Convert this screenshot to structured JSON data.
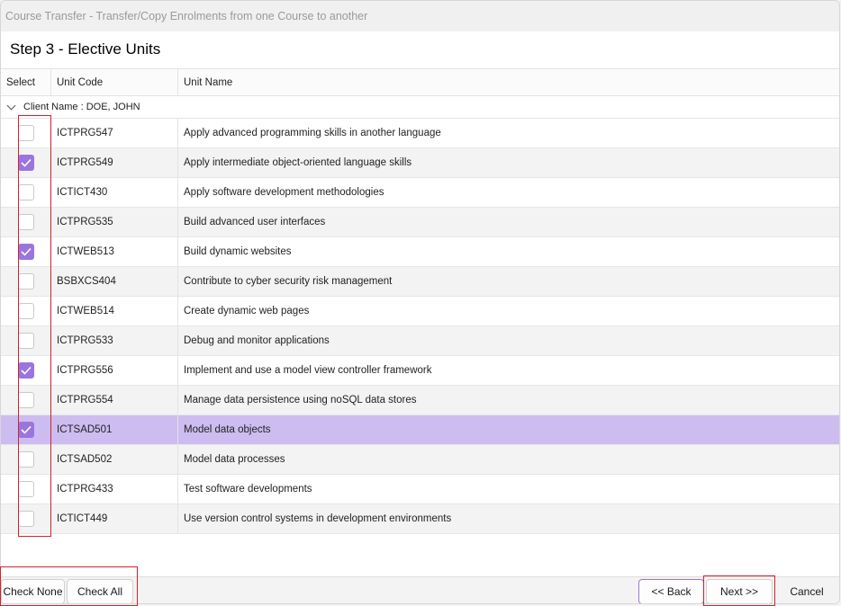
{
  "window": {
    "title": "Course Transfer  - Transfer/Copy Enrolments from one Course to another",
    "step_title": "Step 3 - Elective Units"
  },
  "grid": {
    "columns": {
      "select": "Select",
      "code": "Unit Code",
      "name": "Unit Name"
    },
    "group_label": "Client Name : DOE, JOHN",
    "rows": [
      {
        "code": "ICTPRG547",
        "name": "Apply advanced programming skills in another language",
        "checked": false,
        "selected": false
      },
      {
        "code": "ICTPRG549",
        "name": "Apply intermediate object-oriented language skills",
        "checked": true,
        "selected": false
      },
      {
        "code": "ICTICT430",
        "name": "Apply software development methodologies",
        "checked": false,
        "selected": false
      },
      {
        "code": "ICTPRG535",
        "name": "Build advanced user interfaces",
        "checked": false,
        "selected": false
      },
      {
        "code": "ICTWEB513",
        "name": "Build dynamic websites",
        "checked": true,
        "selected": false
      },
      {
        "code": "BSBXCS404",
        "name": "Contribute to cyber security risk management",
        "checked": false,
        "selected": false
      },
      {
        "code": "ICTWEB514",
        "name": "Create dynamic web pages",
        "checked": false,
        "selected": false
      },
      {
        "code": "ICTPRG533",
        "name": "Debug and monitor applications",
        "checked": false,
        "selected": false
      },
      {
        "code": "ICTPRG556",
        "name": "Implement and use a model view controller framework",
        "checked": true,
        "selected": false
      },
      {
        "code": "ICTPRG554",
        "name": "Manage data persistence using noSQL data stores",
        "checked": false,
        "selected": false
      },
      {
        "code": "ICTSAD501",
        "name": "Model data objects",
        "checked": true,
        "selected": true
      },
      {
        "code": "ICTSAD502",
        "name": "Model data processes",
        "checked": false,
        "selected": false
      },
      {
        "code": "ICTPRG433",
        "name": "Test software developments",
        "checked": false,
        "selected": false
      },
      {
        "code": "ICTICT449",
        "name": "Use version control systems in development environments",
        "checked": false,
        "selected": false
      }
    ]
  },
  "footer": {
    "check_none": "Check None",
    "check_all": "Check All",
    "back": "<< Back",
    "next": "Next >>",
    "cancel": "Cancel"
  },
  "colors": {
    "accent": "#9a75e0",
    "selected_row": "#cdbcf0",
    "annotation_red": "#d91f26"
  }
}
